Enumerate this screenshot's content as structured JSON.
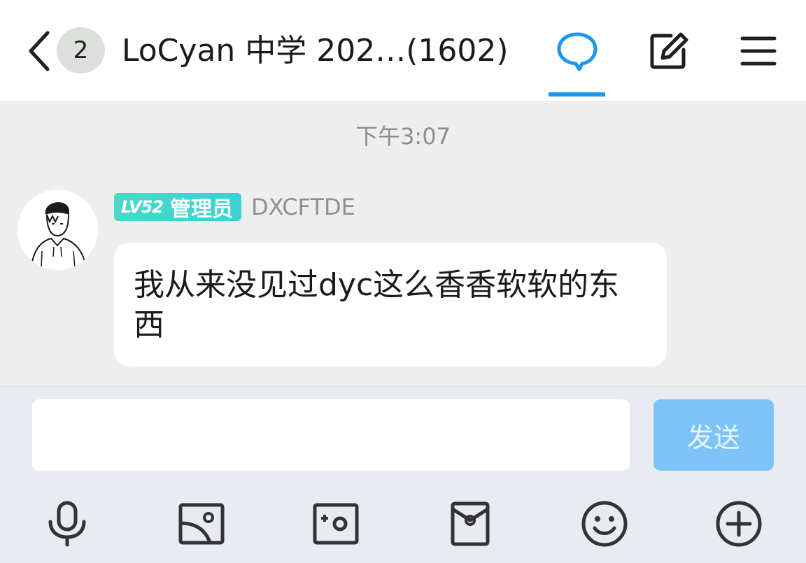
{
  "header": {
    "unread_count": "2",
    "title": "LoCyan 中学 202…(1602)",
    "accent_color": "#1a98ef",
    "icons": [
      "back-chevron-icon",
      "chat-bubble-icon",
      "edit-icon",
      "menu-icon"
    ]
  },
  "messages": {
    "timestamp": "下午3:07",
    "items": [
      {
        "level": "LV52",
        "role": "管理员",
        "sender": "DXCFTDE",
        "text": "我从来没见过dyc这么香香软软的东西"
      }
    ]
  },
  "composer": {
    "input_value": "",
    "send_label": "发送",
    "send_color": "#7ec3f5"
  },
  "toolbar": {
    "icons": [
      "microphone-icon",
      "image-icon",
      "camera-icon",
      "red-packet-icon",
      "emoji-icon",
      "plus-icon"
    ]
  }
}
